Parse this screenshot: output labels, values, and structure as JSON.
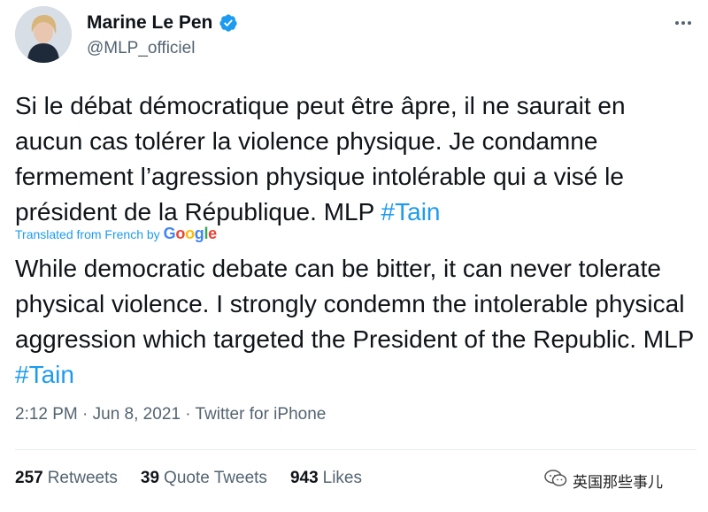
{
  "author": {
    "name": "Marine Le Pen",
    "handle": "@MLP_officiel",
    "verified_icon": "verified-badge-icon"
  },
  "tweet": {
    "text_parts": [
      "Si le débat démocratique peut être âpre, il ne saurait en aucun cas tolérer la violence physique. Je condamne fermement l’agression physique intolérable qui a visé le président de la République. MLP ",
      "#Tain"
    ],
    "translated_label": "Translated from French by",
    "google": [
      "G",
      "o",
      "o",
      "g",
      "l",
      "e"
    ],
    "translation_parts": [
      "While democratic debate can be bitter, it can never tolerate physical violence. I strongly condemn the intolerable physical aggression which targeted the President of the Republic. MLP ",
      "#Tain"
    ],
    "meta": "2:12 PM · Jun 8, 2021 · Twitter for iPhone"
  },
  "stats": {
    "retweets_count": "257",
    "retweets_label": "Retweets",
    "quotes_count": "39",
    "quotes_label": "Quote Tweets",
    "likes_count": "943",
    "likes_label": "Likes"
  },
  "watermark": "英国那些事儿",
  "colors": {
    "accent": "#1d9bf0",
    "text": "#0f1419",
    "secondary": "#536471"
  }
}
